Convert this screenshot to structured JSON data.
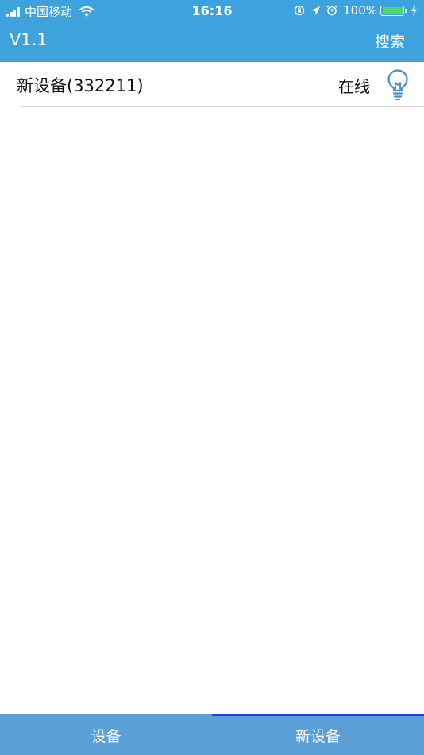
{
  "status_bar": {
    "carrier": "中国移动",
    "time": "16:16",
    "battery_percent": "100%",
    "battery_level": 1.0,
    "icons": [
      "signal-icon",
      "wifi-icon",
      "orientation-lock-icon",
      "location-arrow-icon",
      "alarm-icon",
      "battery-icon",
      "charging-bolt-icon"
    ]
  },
  "header": {
    "title": "V1.1",
    "search_label": "搜索"
  },
  "devices": [
    {
      "name": "新设备(332211)",
      "status": "在线",
      "icon": "lightbulb-icon"
    }
  ],
  "tabs": [
    {
      "label": "设备",
      "active": false
    },
    {
      "label": "新设备",
      "active": true
    }
  ],
  "colors": {
    "header_bg": "#3ea3dc",
    "tab_bg": "#5aa0d6",
    "tab_active_indicator": "#1e3ee6",
    "bulb_icon": "#4a8fc4"
  }
}
